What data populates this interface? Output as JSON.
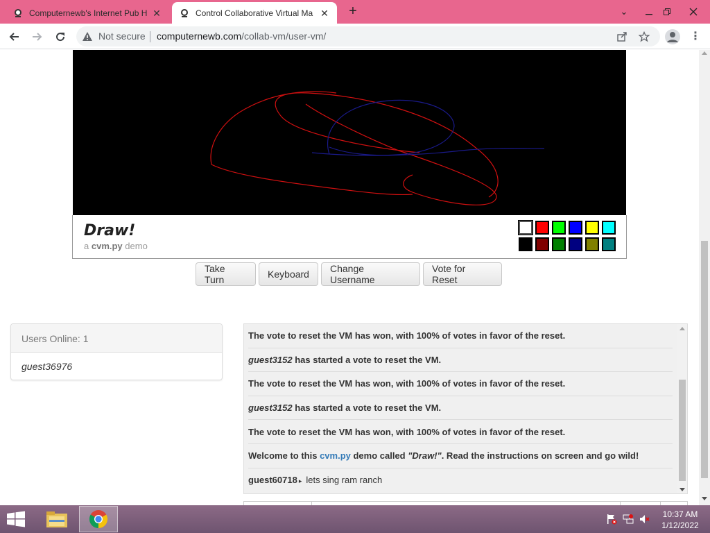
{
  "browser": {
    "tabs": [
      {
        "title": "Computernewb's Internet Pub H",
        "active": false
      },
      {
        "title": "Control Collaborative Virtual Ma",
        "active": true
      }
    ],
    "security_label": "Not secure",
    "url_host": "computernewb.com",
    "url_path": "/collab-vm/user-vm/",
    "accent_color": "#e8668e"
  },
  "vm": {
    "title": "Draw!",
    "subtitle_prefix": "a",
    "subtitle_bold": "cvm.py",
    "subtitle_suffix": "demo",
    "palette": [
      "#ffffff",
      "#ff0000",
      "#00ff00",
      "#0000ff",
      "#ffff00",
      "#00ffff",
      "#000000",
      "#800000",
      "#008000",
      "#000080",
      "#808000",
      "#008080"
    ],
    "selected_color": "#ffffff"
  },
  "buttons": {
    "take_turn": "Take Turn",
    "keyboard": "Keyboard",
    "change_username": "Change Username",
    "vote_reset": "Vote for Reset"
  },
  "users": {
    "header": "Users Online: 1",
    "list": [
      "guest36976"
    ]
  },
  "chat": {
    "messages": [
      {
        "type": "system",
        "text": "The vote to reset the VM has won, with 100% of votes in favor of the reset."
      },
      {
        "type": "vote",
        "user": "guest3152",
        "text": " has started a vote to reset the VM."
      },
      {
        "type": "system",
        "text": "The vote to reset the VM has won, with 100% of votes in favor of the reset."
      },
      {
        "type": "vote",
        "user": "guest3152",
        "text": " has started a vote to reset the VM."
      },
      {
        "type": "system",
        "text": "The vote to reset the VM has won, with 100% of votes in favor of the reset."
      },
      {
        "type": "welcome",
        "pre": "Welcome to this ",
        "link": "cvm.py",
        "mid": " demo called ",
        "quote": "\"Draw!\"",
        "post": ". Read the instructions on screen and go wild!"
      },
      {
        "type": "user",
        "user": "guest60718",
        "arrow": "▸",
        "text": "lets sing ram ranch"
      }
    ]
  },
  "taskbar": {
    "time": "10:37 AM",
    "date": "1/12/2022"
  }
}
